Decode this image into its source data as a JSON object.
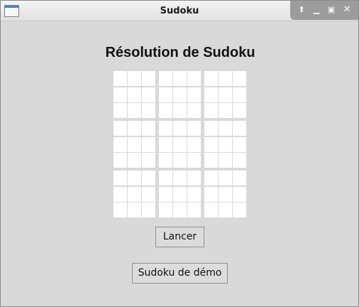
{
  "window": {
    "title": "Sudoku",
    "controls": {
      "shade_icon": "arrow-up-icon",
      "minimize_icon": "minimize-icon",
      "maximize_icon": "maximize-icon",
      "close_icon": "close-icon"
    }
  },
  "main": {
    "heading": "Résolution de Sudoku",
    "grid_size": 9,
    "cells": [
      "",
      "",
      "",
      "",
      "",
      "",
      "",
      "",
      "",
      "",
      "",
      "",
      "",
      "",
      "",
      "",
      "",
      "",
      "",
      "",
      "",
      "",
      "",
      "",
      "",
      "",
      "",
      "",
      "",
      "",
      "",
      "",
      "",
      "",
      "",
      "",
      "",
      "",
      "",
      "",
      "",
      "",
      "",
      "",
      "",
      "",
      "",
      "",
      "",
      "",
      "",
      "",
      "",
      "",
      "",
      "",
      "",
      "",
      "",
      "",
      "",
      "",
      "",
      "",
      "",
      "",
      "",
      "",
      "",
      "",
      "",
      "",
      "",
      "",
      "",
      "",
      "",
      "",
      "",
      "",
      "",
      "",
      "",
      "",
      ""
    ]
  },
  "buttons": {
    "run_label": "Lancer",
    "demo_label": "Sudoku de démo"
  }
}
